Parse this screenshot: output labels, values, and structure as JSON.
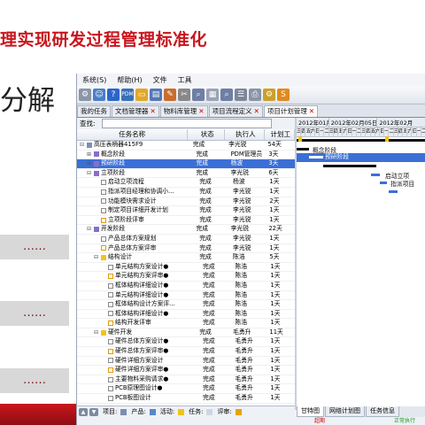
{
  "slide": {
    "title": "理实现研发过程管理标准化",
    "subtitle": "分解",
    "pills": [
      "……",
      "……",
      "……"
    ]
  },
  "menu": [
    "系统(S)",
    "帮助(H)",
    "文件",
    "工具"
  ],
  "tabs": [
    {
      "label": "我的任务",
      "closable": false,
      "active": false
    },
    {
      "label": "文档管理器",
      "closable": true,
      "active": false
    },
    {
      "label": "物料库管理",
      "closable": true,
      "active": false
    },
    {
      "label": "项目流程定义",
      "closable": true,
      "active": false
    },
    {
      "label": "项目计划管理",
      "closable": true,
      "active": true
    }
  ],
  "search": {
    "label": "查找:"
  },
  "grid": {
    "columns": [
      "任务名称",
      "状态",
      "执行人",
      "计划工"
    ],
    "rows": [
      {
        "tg": "⊟",
        "indent": 0,
        "icon": "proj",
        "name": "高压表柄器415F9",
        "status": "完成",
        "assignee": "李光锐",
        "plan": "54天",
        "sel": false
      },
      {
        "tg": "⊞",
        "indent": 1,
        "icon": "stage",
        "name": "概念阶段",
        "status": "完成",
        "assignee": "PDM管理员",
        "plan": "3天",
        "sel": false
      },
      {
        "tg": "⊞",
        "indent": 1,
        "icon": "stage",
        "name": "预研阶段",
        "status": "完成",
        "assignee": "杨波",
        "plan": "3天",
        "sel": true
      },
      {
        "tg": "⊟",
        "indent": 1,
        "icon": "stage",
        "name": "立项阶段",
        "status": "完成",
        "assignee": "李光锐",
        "plan": "6天",
        "sel": false
      },
      {
        "tg": "",
        "indent": 2,
        "icon": "task",
        "name": "启动立项流程",
        "status": "完成",
        "assignee": "杨波",
        "plan": "1天",
        "sel": false
      },
      {
        "tg": "",
        "indent": 2,
        "icon": "task",
        "name": "指派项目经理和协调小...",
        "status": "完成",
        "assignee": "李光锐",
        "plan": "1天",
        "sel": false
      },
      {
        "tg": "",
        "indent": 2,
        "icon": "task",
        "name": "功能模块需求设计",
        "status": "完成",
        "assignee": "李光锐",
        "plan": "2天",
        "sel": false
      },
      {
        "tg": "",
        "indent": 2,
        "icon": "task",
        "name": "制定项目详细开发计划",
        "status": "完成",
        "assignee": "李光锐",
        "plan": "1天",
        "sel": false
      },
      {
        "tg": "",
        "indent": 2,
        "icon": "rev",
        "name": "立项阶段评审",
        "status": "完成",
        "assignee": "李光锐",
        "plan": "1天",
        "sel": false
      },
      {
        "tg": "⊟",
        "indent": 1,
        "icon": "stage",
        "name": "开发阶段",
        "status": "完成",
        "assignee": "李光锐",
        "plan": "22天",
        "sel": false
      },
      {
        "tg": "",
        "indent": 2,
        "icon": "task",
        "name": "产品总体方案规划",
        "status": "完成",
        "assignee": "李光锐",
        "plan": "1天",
        "sel": false
      },
      {
        "tg": "",
        "indent": 2,
        "icon": "rev",
        "name": "产品总体方案评审",
        "status": "完成",
        "assignee": "李光锐",
        "plan": "1天",
        "sel": false
      },
      {
        "tg": "⊟",
        "indent": 2,
        "icon": "act",
        "name": "结构设计",
        "status": "完成",
        "assignee": "陈浩",
        "plan": "5天",
        "sel": false
      },
      {
        "tg": "",
        "indent": 3,
        "icon": "task",
        "name": "单元结构方案设计●",
        "status": "完成",
        "assignee": "陈浩",
        "plan": "1天",
        "sel": false
      },
      {
        "tg": "",
        "indent": 3,
        "icon": "rev",
        "name": "单元结构方案评审●",
        "status": "完成",
        "assignee": "陈浩",
        "plan": "1天",
        "sel": false
      },
      {
        "tg": "",
        "indent": 3,
        "icon": "task",
        "name": "框体结构详细设计●",
        "status": "完成",
        "assignee": "陈浩",
        "plan": "1天",
        "sel": false
      },
      {
        "tg": "",
        "indent": 3,
        "icon": "task",
        "name": "单元结构详细设计●",
        "status": "完成",
        "assignee": "陈浩",
        "plan": "1天",
        "sel": false
      },
      {
        "tg": "",
        "indent": 3,
        "icon": "task",
        "name": "框体结构设计方案评...",
        "status": "完成",
        "assignee": "陈浩",
        "plan": "1天",
        "sel": false
      },
      {
        "tg": "",
        "indent": 3,
        "icon": "task",
        "name": "框体结构详细设计●",
        "status": "完成",
        "assignee": "陈浩",
        "plan": "1天",
        "sel": false
      },
      {
        "tg": "",
        "indent": 3,
        "icon": "rev",
        "name": "结构开发评审",
        "status": "完成",
        "assignee": "陈浩",
        "plan": "1天",
        "sel": false
      },
      {
        "tg": "⊟",
        "indent": 2,
        "icon": "act",
        "name": "硬件开发",
        "status": "完成",
        "assignee": "毛勇升",
        "plan": "11天",
        "sel": false
      },
      {
        "tg": "",
        "indent": 3,
        "icon": "task",
        "name": "硬件总体方案设计●",
        "status": "完成",
        "assignee": "毛勇升",
        "plan": "1天",
        "sel": false
      },
      {
        "tg": "",
        "indent": 3,
        "icon": "rev",
        "name": "硬件总体方案评审●",
        "status": "完成",
        "assignee": "毛勇升",
        "plan": "1天",
        "sel": false
      },
      {
        "tg": "",
        "indent": 3,
        "icon": "task",
        "name": "硬件详细方案设计",
        "status": "完成",
        "assignee": "毛勇升",
        "plan": "1天",
        "sel": false
      },
      {
        "tg": "",
        "indent": 3,
        "icon": "rev",
        "name": "硬件详细方案评审●",
        "status": "完成",
        "assignee": "毛勇升",
        "plan": "1天",
        "sel": false
      },
      {
        "tg": "",
        "indent": 3,
        "icon": "task",
        "name": "主要物料采购请求●",
        "status": "完成",
        "assignee": "毛勇升",
        "plan": "1天",
        "sel": false
      },
      {
        "tg": "",
        "indent": 3,
        "icon": "task",
        "name": "PCB原理图设计●",
        "status": "完成",
        "assignee": "毛勇升",
        "plan": "1天",
        "sel": false
      },
      {
        "tg": "",
        "indent": 3,
        "icon": "task",
        "name": "PCB板图设计",
        "status": "完成",
        "assignee": "毛勇升",
        "plan": "1天",
        "sel": false
      }
    ]
  },
  "gantt": {
    "months": [
      "2012年01月29日",
      "2012年02月05日",
      "2012年02月"
    ],
    "day_labels": [
      "三",
      "四",
      "五",
      "六",
      "日",
      "一",
      "二",
      "三",
      "四",
      "五",
      "六",
      "日",
      "一",
      "二",
      "三",
      "四",
      "五",
      "六",
      "日",
      "一",
      "二",
      "三",
      "四",
      "五",
      "六",
      "日",
      "一",
      "二"
    ],
    "labels": {
      "concept": "概念阶段",
      "pre": "预研阶段",
      "start": "启动立项",
      "assign": "指派项目"
    }
  },
  "legend": [
    {
      "label": "项目:",
      "color": "#7c8fb0"
    },
    {
      "label": "产品:",
      "color": "#5a86c9"
    },
    {
      "label": "活动:",
      "color": "#f0c419"
    },
    {
      "label": "任务:",
      "color": "#cfd6e2"
    },
    {
      "label": "评审:",
      "color": "#e8a200"
    }
  ],
  "bottom_tabs": [
    "甘特图",
    "网络计划图",
    "任务信息"
  ],
  "status": {
    "left": "超期",
    "right": "正常执行"
  }
}
